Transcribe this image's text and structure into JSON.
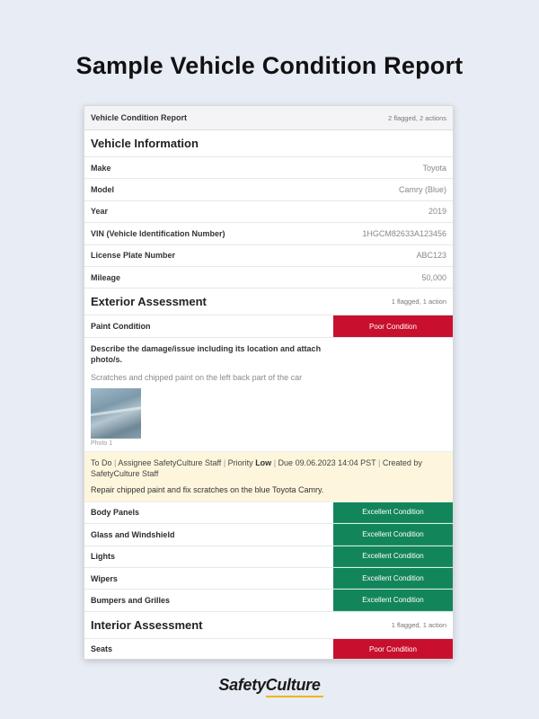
{
  "page_title": "Sample Vehicle Condition Report",
  "report": {
    "title": "Vehicle Condition Report",
    "summary": "2 flagged, 2 actions"
  },
  "vehicle_info": {
    "heading": "Vehicle Information",
    "fields": [
      {
        "label": "Make",
        "value": "Toyota"
      },
      {
        "label": "Model",
        "value": "Camry (Blue)"
      },
      {
        "label": "Year",
        "value": "2019"
      },
      {
        "label": "VIN (Vehicle Identification Number)",
        "value": "1HGCM82633A123456"
      },
      {
        "label": "License Plate Number",
        "value": "ABC123"
      },
      {
        "label": "Mileage",
        "value": "50,000"
      }
    ]
  },
  "exterior": {
    "heading": "Exterior Assessment",
    "summary": "1 flagged, 1 action",
    "paint": {
      "label": "Paint Condition",
      "rating": "Poor Condition"
    },
    "damage_question": "Describe the damage/issue including its location and attach photo/s.",
    "damage_answer": "Scratches and chipped paint on the left back part of the car",
    "photo_caption": "Photo 1",
    "action": {
      "status": "To Do",
      "assignee_label": "Assignee",
      "assignee": "SafetyCulture Staff",
      "priority_label": "Priority",
      "priority": "Low",
      "due_label": "Due",
      "due": "09.06.2023 14:04 PST",
      "created_label": "Created by",
      "created_by": "SafetyCulture Staff",
      "description": "Repair chipped paint and fix scratches on the blue Toyota Camry."
    },
    "items": [
      {
        "label": "Body Panels",
        "rating": "Excellent Condition"
      },
      {
        "label": "Glass and Windshield",
        "rating": "Excellent Condition"
      },
      {
        "label": "Lights",
        "rating": "Excellent Condition"
      },
      {
        "label": "Wipers",
        "rating": "Excellent Condition"
      },
      {
        "label": "Bumpers and Grilles",
        "rating": "Excellent Condition"
      }
    ]
  },
  "interior": {
    "heading": "Interior Assessment",
    "summary": "1 flagged, 1 action",
    "seats": {
      "label": "Seats",
      "rating": "Poor Condition"
    }
  },
  "brand": {
    "logo_text": "SafetyCulture"
  },
  "colors": {
    "poor": "#c8102e",
    "excellent": "#13855a",
    "action_bg": "#fdf6dc",
    "brand_accent": "#f2b400"
  }
}
